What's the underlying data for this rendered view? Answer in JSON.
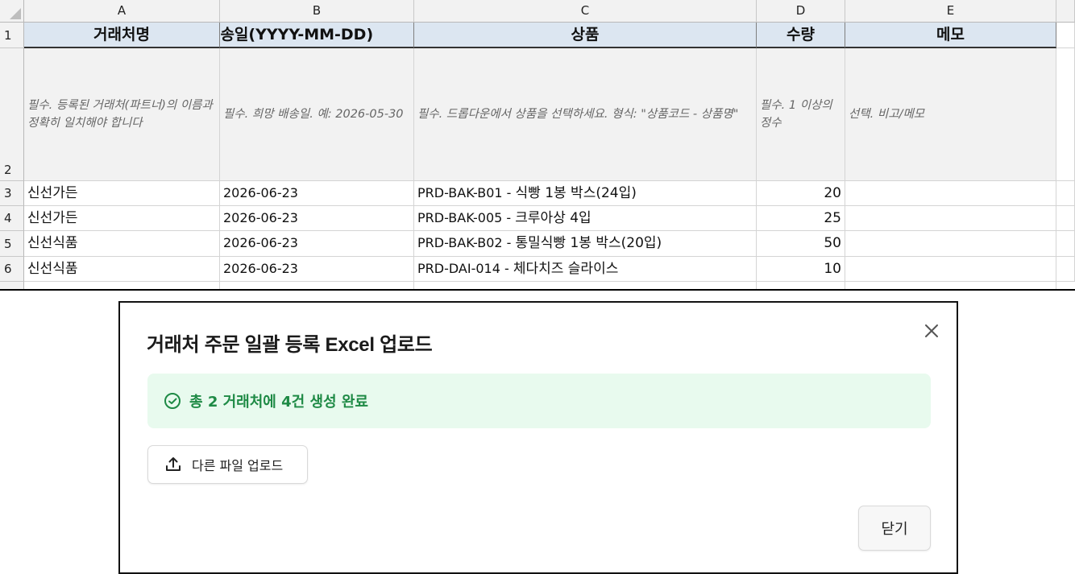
{
  "sheet": {
    "columns": [
      "A",
      "B",
      "C",
      "D",
      "E"
    ],
    "row_numbers": [
      "1",
      "2",
      "3",
      "4",
      "5",
      "6"
    ],
    "headers": [
      "거래처명",
      "희망배송일(YYYY-MM-DD)",
      "상품",
      "수량",
      "메모"
    ],
    "descriptions": [
      "필수. 등록된 거래처(파트너)의 이름과 정확히 일치해야 합니다",
      "필수. 희망 배송일. 예: 2026-05-30",
      "필수. 드롭다운에서 상품을 선택하세요. 형식: \"상품코드 - 상품명\"",
      "필수. 1 이상의 정수",
      "선택. 비고/메모"
    ],
    "rows": [
      {
        "partner": "신선가든",
        "date": "2026-06-23",
        "product_code": "PRD-BAK-B01 - ",
        "product_name": "식빵 1봉 박스(24입)",
        "qty": "20",
        "memo": ""
      },
      {
        "partner": "신선가든",
        "date": "2026-06-23",
        "product_code": "PRD-BAK-005 - ",
        "product_name": "크루아상 4입",
        "qty": "25",
        "memo": ""
      },
      {
        "partner": "신선식품",
        "date": "2026-06-23",
        "product_code": "PRD-BAK-B02 - ",
        "product_name": "통밀식빵 1봉 박스(20입)",
        "qty": "50",
        "memo": ""
      },
      {
        "partner": "신선식품",
        "date": "2026-06-23",
        "product_code": "PRD-DAI-014 - ",
        "product_name": "체다치즈 슬라이스",
        "qty": "10",
        "memo": ""
      }
    ]
  },
  "dialog": {
    "title": "거래처 주문 일괄 등록 Excel 업로드",
    "close_icon": "close-icon",
    "success_icon": "check-circle-icon",
    "success_message": "총 2 거래처에 4건 생성 완료",
    "upload_icon": "upload-icon",
    "upload_button_label": "다른 파일 업로드",
    "close_button_label": "닫기",
    "colors": {
      "success_bg": "#e8faee",
      "success_text": "#1e8a45",
      "header_fill": "#dce6f1"
    }
  }
}
